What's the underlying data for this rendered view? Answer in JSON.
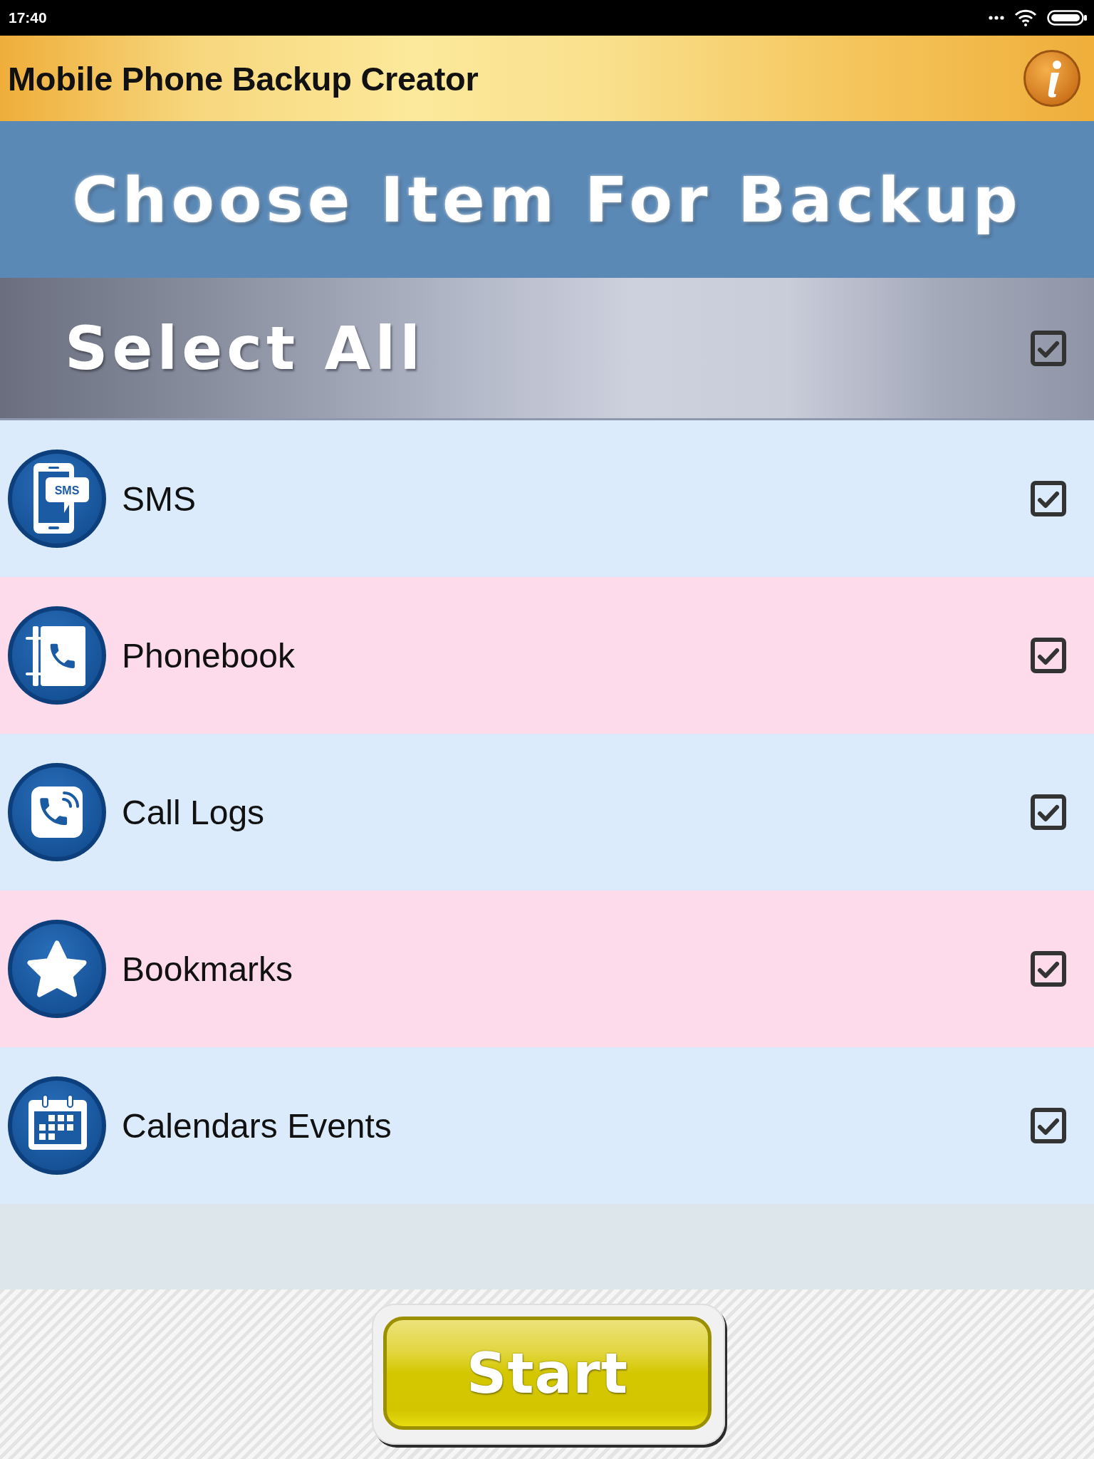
{
  "status_bar": {
    "time": "17:40"
  },
  "app_bar": {
    "title": "Mobile Phone Backup Creator"
  },
  "banner": {
    "title": "Choose Item For Backup"
  },
  "select_all": {
    "label": "Select All",
    "checked": true
  },
  "items": [
    {
      "kind": "sms",
      "icon_text": "SMS",
      "label": "SMS",
      "checked": true
    },
    {
      "kind": "phonebook",
      "label": "Phonebook",
      "checked": true
    },
    {
      "kind": "call_log",
      "label": "Call Logs",
      "checked": true
    },
    {
      "kind": "bookmark",
      "label": "Bookmarks",
      "checked": true
    },
    {
      "kind": "calendar",
      "label": "Calendars Events",
      "checked": true
    }
  ],
  "start_button": {
    "label": "Start"
  }
}
